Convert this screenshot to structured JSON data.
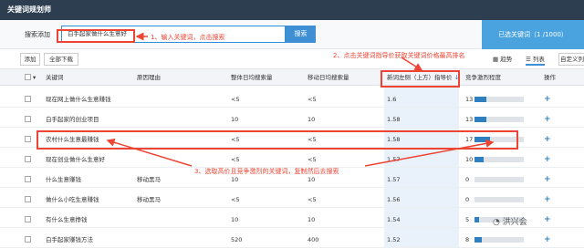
{
  "title": "关键词规划师",
  "search": {
    "label": "搜索添加",
    "value": "白手起家做什么生意好",
    "button": "搜索"
  },
  "selected_panel": "已选关键词（1 /1000）",
  "toolbar": {
    "add": "添加",
    "download_all": "全部下载",
    "tab_trend": "趋势",
    "tab_list": "列表",
    "custom": "自定义列"
  },
  "columns": {
    "keyword": "关键词",
    "reason": "原因理由",
    "daily_search": "整体日均搜索量",
    "mobile_search": "移动日均搜索量",
    "bid": "新词左侧（上方）指导价",
    "competition": "竞争激烈程度",
    "action": "操作"
  },
  "rows": [
    {
      "keyword": "现在网上做什么生意赚钱",
      "reason": "",
      "daily": "<5",
      "mobile": "<5",
      "bid": "1.6",
      "comp": "13",
      "comp_level": 0.24
    },
    {
      "keyword": "白手起家的创业项目",
      "reason": "",
      "daily": "10",
      "mobile": "10",
      "bid": "1.58",
      "comp": "13",
      "comp_level": 0.24
    },
    {
      "keyword": "农村什么生意最赚钱",
      "reason": "",
      "daily": "<5",
      "mobile": "<5",
      "bid": "1.58",
      "comp": "17",
      "comp_level": 0.31
    },
    {
      "keyword": "现在创业做什么生意好",
      "reason": "",
      "daily": "<5",
      "mobile": "<5",
      "bid": "1.57",
      "comp": "10",
      "comp_level": 0.18
    },
    {
      "keyword": "什么生意赚钱",
      "reason": "移动黑马",
      "daily": "10",
      "mobile": "10",
      "bid": "1.57",
      "comp": "0",
      "comp_level": 0.0
    },
    {
      "keyword": "做什么小吃生意赚钱",
      "reason": "移动黑马",
      "daily": "<5",
      "mobile": "<5",
      "bid": "1.56",
      "comp": "0",
      "comp_level": 0.0
    },
    {
      "keyword": "有什么生意挣钱",
      "reason": "",
      "daily": "10",
      "mobile": "10",
      "bid": "1.54",
      "comp": "5",
      "comp_level": 0.09
    },
    {
      "keyword": "白手起家赚钱方法",
      "reason": "",
      "daily": "520",
      "mobile": "400",
      "bid": "1.52",
      "comp": "8",
      "comp_level": 0.15
    }
  ],
  "annotations": {
    "a1": "1、输入关键词，点击搜索",
    "a2": "2、点击关键词指导价获取关键词价格最高排名",
    "a3": "3、选取高价且竞争激烈的关键词，复制然后去搜索"
  },
  "watermark": "洪兴会",
  "colors": {
    "header": "#2c3e50",
    "accent": "#3e8fd4",
    "annotation": "#e43"
  }
}
